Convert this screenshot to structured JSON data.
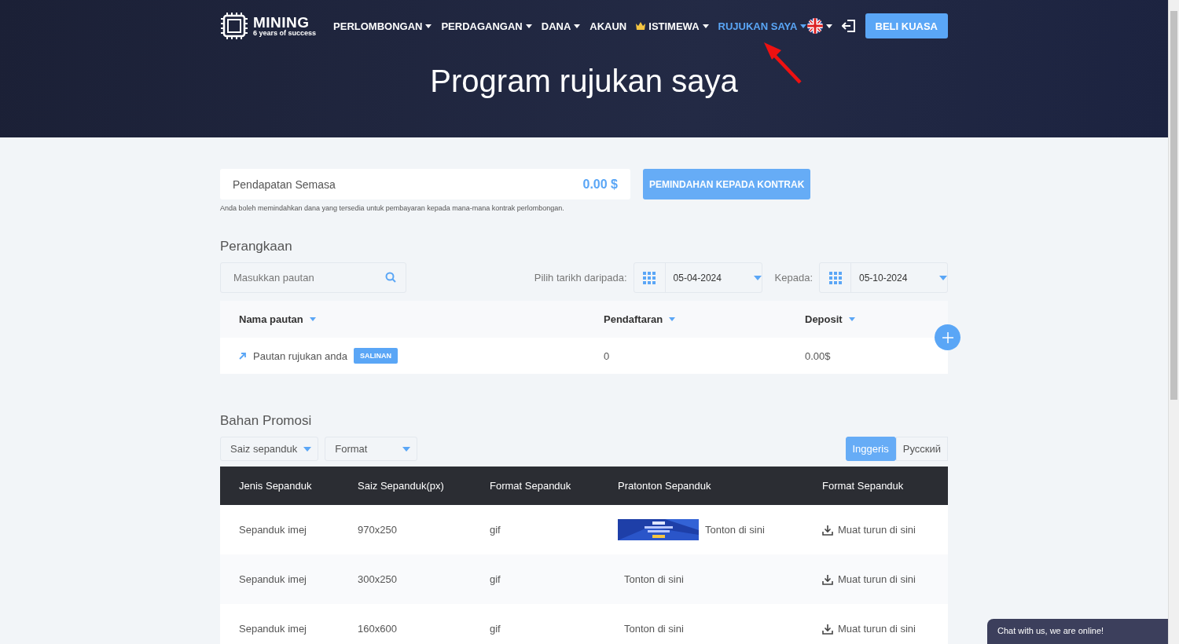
{
  "header": {
    "logo": {
      "name": "MINING",
      "tagline": "6 years of success"
    },
    "nav": [
      {
        "label": "PERLOMBONGAN",
        "dropdown": true,
        "selected": false,
        "kind": "plain"
      },
      {
        "label": "PERDAGANGAN",
        "dropdown": true,
        "selected": false,
        "kind": "plain"
      },
      {
        "label": "DANA",
        "dropdown": true,
        "selected": false,
        "kind": "plain"
      },
      {
        "label": "AKAUN",
        "dropdown": false,
        "selected": false,
        "kind": "plain"
      },
      {
        "label": "ISTIMEWA",
        "dropdown": true,
        "selected": false,
        "kind": "premium"
      },
      {
        "label": "RUJUKAN SAYA",
        "dropdown": true,
        "selected": true,
        "kind": "plain"
      }
    ],
    "buy_button": "BELI KUASA",
    "page_title": "Program rujukan saya"
  },
  "earnings": {
    "label": "Pendapatan Semasa",
    "amount": "0.00 $",
    "button": "PEMINDAHAN KEPADA KONTRAK",
    "note": "Anda boleh memindahkan dana yang tersedia untuk pembayaran kepada mana-mana kontrak perlombongan."
  },
  "links": {
    "title": "Perangkaan",
    "search_placeholder": "Masukkan pautan",
    "date_from_label": "Pilih tarikh daripada:",
    "date_from": "05-04-2024",
    "date_to_label": "Kepada:",
    "date_to": "05-10-2024",
    "columns": [
      "Nama pautan",
      "Pendaftaran",
      "Deposit"
    ],
    "rows": [
      {
        "name": "Pautan rujukan anda",
        "copy_button": "SALINAN",
        "registrations": "0",
        "deposit": "0.00$"
      }
    ]
  },
  "promo": {
    "title": "Bahan Promosi",
    "filters": [
      "Saiz sepanduk",
      "Format"
    ],
    "languages": [
      {
        "label": "Inggeris",
        "selected": true
      },
      {
        "label": "Русский",
        "selected": false
      }
    ],
    "columns": [
      "Jenis Sepanduk",
      "Saiz Sepanduk(px)",
      "Format Sepanduk",
      "Pratonton Sepanduk",
      "Format Sepanduk"
    ],
    "rows": [
      {
        "type": "Sepanduk imej",
        "size": "970x250",
        "format": "gif",
        "has_thumbnail": true,
        "preview": "Tonton di sini",
        "download": "Muat turun di sini"
      },
      {
        "type": "Sepanduk imej",
        "size": "300x250",
        "format": "gif",
        "has_thumbnail": false,
        "preview": "Tonton di sini",
        "download": "Muat turun di sini"
      },
      {
        "type": "Sepanduk imej",
        "size": "160x600",
        "format": "gif",
        "has_thumbnail": false,
        "preview": "Tonton di sini",
        "download": "Muat turun di sini"
      }
    ]
  },
  "chat": "Chat with us, we are online!"
}
